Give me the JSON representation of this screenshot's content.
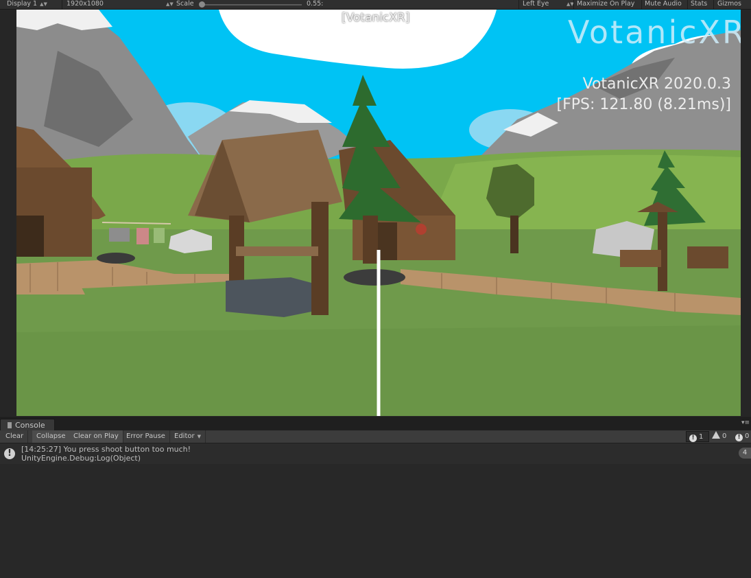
{
  "toolbar": {
    "display": "Display 1",
    "resolution": "1920x1080",
    "scale_label": "Scale",
    "scale_value": "0.55:",
    "eye": "Left Eye",
    "maximize": "Maximize On Play",
    "mute": "Mute Audio",
    "stats": "Stats",
    "gizmos": "Gizmos"
  },
  "viewport": {
    "title": "[VotanicXR]",
    "brand": "VotanicXR",
    "version": "VotanicXR 2020.0.3",
    "fps": "[FPS: 121.80 (8.21ms)]"
  },
  "console": {
    "tab_label": "Console",
    "buttons": {
      "clear": "Clear",
      "collapse": "Collapse",
      "clear_on_play": "Clear on Play",
      "error_pause": "Error Pause",
      "editor": "Editor"
    },
    "counts": {
      "info": "1",
      "warnings": "0",
      "errors": "0"
    },
    "entries": [
      {
        "line1": "[14:25:27] You press shoot button too much!",
        "line2": "UnityEngine.Debug:Log(Object)",
        "count": "4"
      }
    ]
  },
  "colors": {
    "sky": "#00c3f4",
    "grass": "#6f9a4b",
    "editor_dark": "#282828"
  }
}
